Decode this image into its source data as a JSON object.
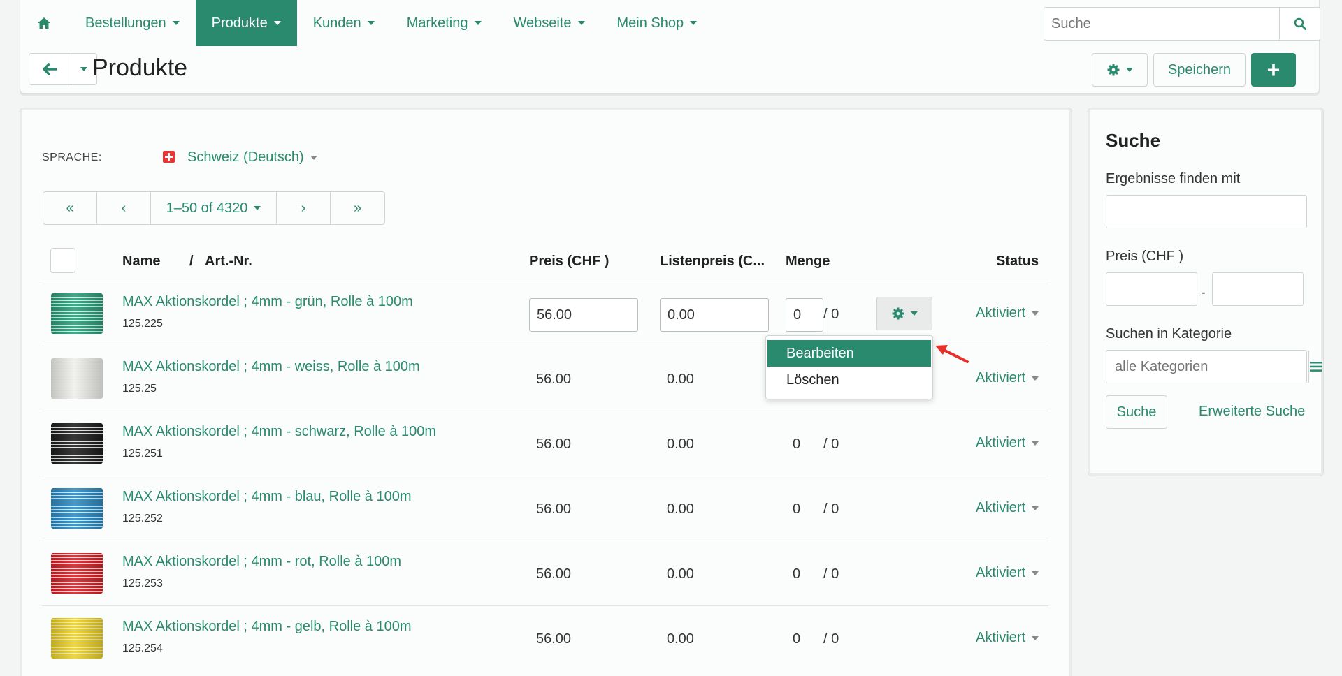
{
  "nav": {
    "items": [
      {
        "label": "Bestellungen"
      },
      {
        "label": "Produkte"
      },
      {
        "label": "Kunden"
      },
      {
        "label": "Marketing"
      },
      {
        "label": "Webseite"
      },
      {
        "label": "Mein Shop"
      }
    ],
    "search_placeholder": "Suche"
  },
  "header": {
    "title": "Produkte",
    "save_label": "Speichern",
    "add_label": "+"
  },
  "language": {
    "label": "SPRACHE:",
    "value": "Schweiz (Deutsch)"
  },
  "pager": {
    "first": "«",
    "prev": "‹",
    "range": "1–50 of 4320",
    "next": "›",
    "last": "»"
  },
  "table": {
    "headers": {
      "name": "Name",
      "sep": "/",
      "artnr": "Art.-Nr.",
      "price": "Preis (CHF )",
      "listprice": "Listenpreis (C...",
      "qty": "Menge",
      "status": "Status"
    },
    "rows": [
      {
        "name": "MAX Aktionskordel ; 4mm - grün, Rolle à 100m",
        "artnr": "125.225",
        "price": "56.00",
        "listprice": "0.00",
        "qty": "0",
        "stock": "/ 0",
        "status": "Aktiviert",
        "color": "#1fa37a"
      },
      {
        "name": "MAX Aktionskordel ; 4mm - weiss, Rolle à 100m",
        "artnr": "125.25",
        "price": "56.00",
        "listprice": "0.00",
        "qty": "",
        "stock": "",
        "status": "Aktiviert",
        "color": "#f0f0ec"
      },
      {
        "name": "MAX Aktionskordel ; 4mm - schwarz, Rolle à 100m",
        "artnr": "125.251",
        "price": "56.00",
        "listprice": "0.00",
        "qty": "0",
        "stock": "/ 0",
        "status": "Aktiviert",
        "color": "#1d1d1d"
      },
      {
        "name": "MAX Aktionskordel ; 4mm - blau, Rolle à 100m",
        "artnr": "125.252",
        "price": "56.00",
        "listprice": "0.00",
        "qty": "0",
        "stock": "/ 0",
        "status": "Aktiviert",
        "color": "#1e8fd0"
      },
      {
        "name": "MAX Aktionskordel ; 4mm - rot, Rolle à 100m",
        "artnr": "125.253",
        "price": "56.00",
        "listprice": "0.00",
        "qty": "0",
        "stock": "/ 0",
        "status": "Aktiviert",
        "color": "#e11b22"
      },
      {
        "name": "MAX Aktionskordel ; 4mm - gelb, Rolle à 100m",
        "artnr": "125.254",
        "price": "56.00",
        "listprice": "0.00",
        "qty": "0",
        "stock": "/ 0",
        "status": "Aktiviert",
        "color": "#f2d40c"
      }
    ]
  },
  "row_menu": {
    "edit": "Bearbeiten",
    "delete": "Löschen"
  },
  "sidebar": {
    "title": "Suche",
    "find_label": "Ergebnisse finden mit",
    "price_label": "Preis (CHF )",
    "price_sep": "-",
    "category_label": "Suchen in Kategorie",
    "category_placeholder": "alle Kategorien",
    "search_button": "Suche",
    "advanced_link": "Erweiterte Suche"
  },
  "colors": {
    "accent": "#2a8a6e",
    "annotation": "#e8302a"
  }
}
